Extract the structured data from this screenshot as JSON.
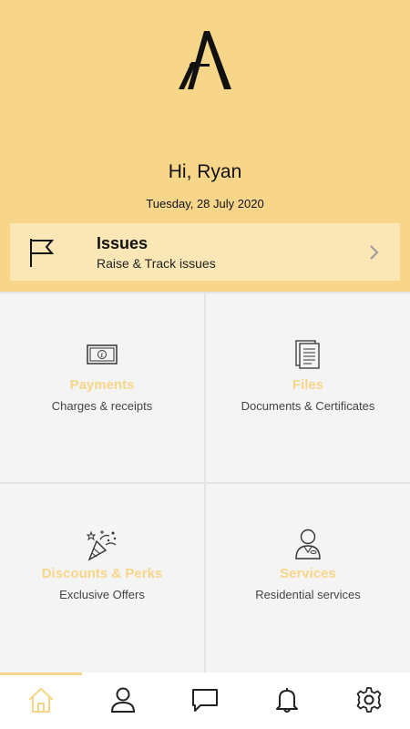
{
  "header": {
    "logo": "brand-logo-A",
    "greeting": "Hi, Ryan",
    "date": "Tuesday, 28 July 2020"
  },
  "issues": {
    "icon": "flag-icon",
    "title": "Issues",
    "subtitle": "Raise & Track issues",
    "chevron": "chevron-right-icon"
  },
  "tiles": [
    {
      "icon": "banknote-icon",
      "title": "Payments",
      "subtitle": "Charges & receipts"
    },
    {
      "icon": "document-icon",
      "title": "Files",
      "subtitle": "Documents & Certificates"
    },
    {
      "icon": "party-popper-icon",
      "title": "Discounts & Perks",
      "subtitle": "Exclusive Offers"
    },
    {
      "icon": "concierge-person-icon",
      "title": "Services",
      "subtitle": "Residential services"
    }
  ],
  "bottom_nav": [
    {
      "icon": "home-icon",
      "active": true
    },
    {
      "icon": "person-icon",
      "active": false
    },
    {
      "icon": "chat-icon",
      "active": false
    },
    {
      "icon": "bell-icon",
      "active": false
    },
    {
      "icon": "gear-icon",
      "active": false
    }
  ],
  "colors": {
    "accent": "#f7d68a",
    "issues_card": "#fbe6b5",
    "tile_bg": "#f4f4f4",
    "divider": "#e4e4e4"
  }
}
